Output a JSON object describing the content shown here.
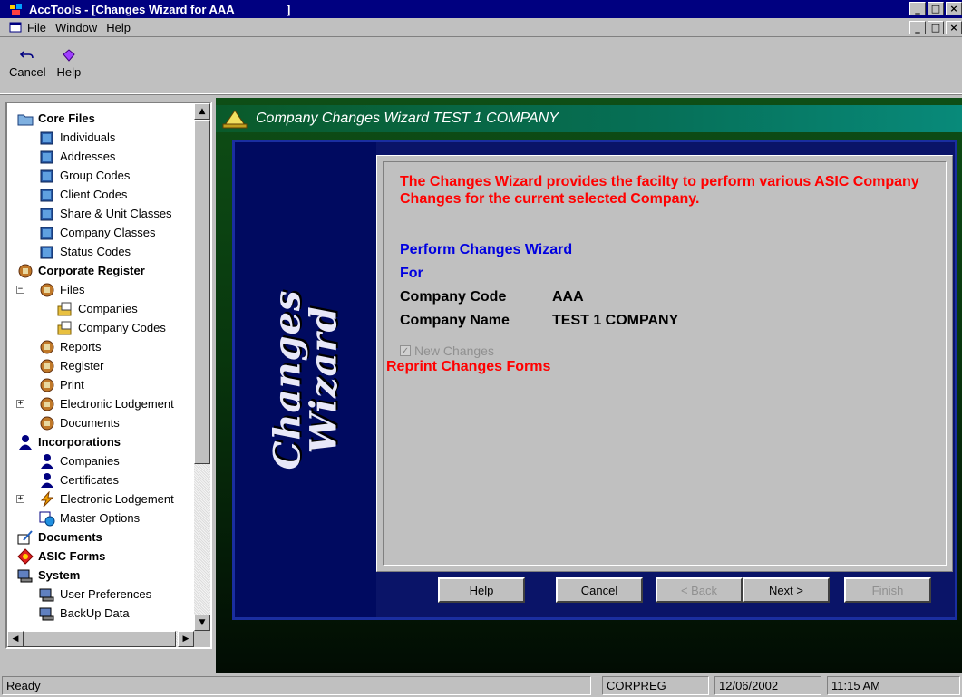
{
  "window": {
    "title": "AccTools - [Changes Wizard for AAA                ]"
  },
  "menubar": {
    "items": [
      "File",
      "Window",
      "Help"
    ]
  },
  "toolbar": {
    "cancel_label": "Cancel",
    "help_label": "Help"
  },
  "tree": {
    "core_files": "Core Files",
    "individuals": "Individuals",
    "addresses": "Addresses",
    "group_codes": "Group Codes",
    "client_codes": "Client Codes",
    "share_unit_classes": "Share & Unit Classes",
    "company_classes": "Company Classes",
    "status_codes": "Status Codes",
    "corporate_register": "Corporate Register",
    "files": "Files",
    "companies": "Companies",
    "company_codes": "Company Codes",
    "reports": "Reports",
    "register": "Register",
    "print": "Print",
    "electronic_lodgement": "Electronic Lodgement",
    "documents_sub": "Documents",
    "incorporations": "Incorporations",
    "inc_companies": "Companies",
    "certificates": "Certificates",
    "inc_electronic_lodgement": "Electronic Lodgement",
    "master_options": "Master Options",
    "documents": "Documents",
    "asic_forms": "ASIC Forms",
    "system": "System",
    "user_preferences": "User Preferences",
    "backup_data": "BackUp Data"
  },
  "wizard": {
    "header_title": "Company Changes Wizard TEST 1 COMPANY",
    "side_line1": "Changes",
    "side_line2": "Wizard",
    "intro": "The Changes Wizard provides the facilty to perform various ASIC Company Changes for the current selected Company.",
    "title": "Perform Changes Wizard",
    "for_label": "For",
    "company_code_label": "Company Code",
    "company_code_value": "AAA",
    "company_name_label": "Company Name",
    "company_name_value": "TEST 1 COMPANY",
    "new_changes_label": "New Changes",
    "reprint_label": "Reprint Changes Forms",
    "buttons": {
      "help": "Help",
      "cancel": "Cancel",
      "back": "< Back",
      "next": "Next >",
      "finish": "Finish"
    }
  },
  "statusbar": {
    "status": "Ready",
    "module": "CORPREG",
    "date": "12/06/2002",
    "time": "11:15 AM"
  }
}
